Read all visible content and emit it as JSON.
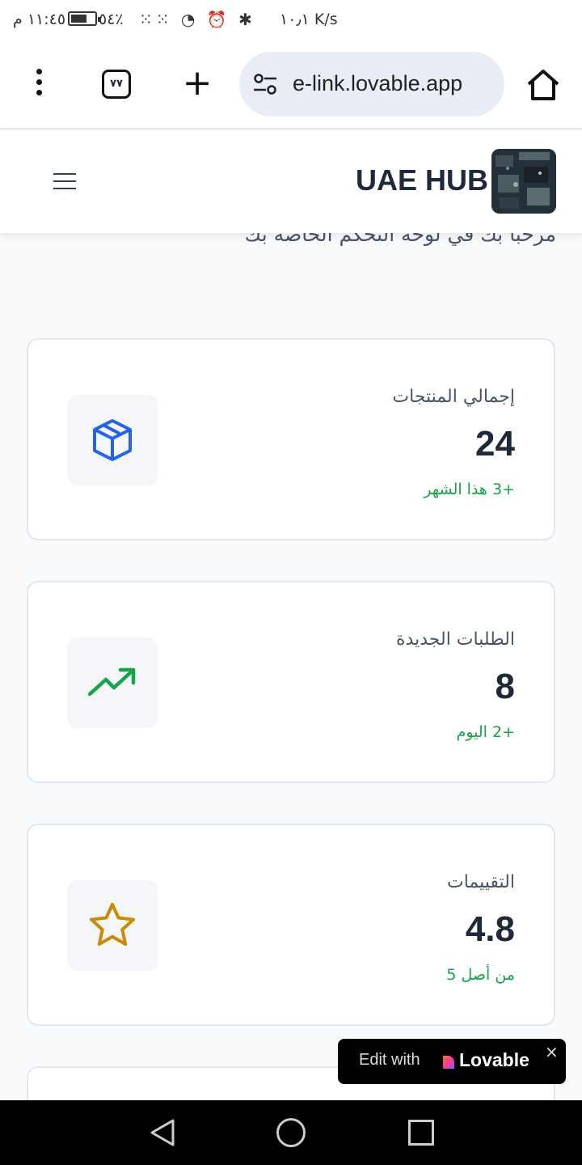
{
  "status_bar": {
    "time": "١١:٤٥ م",
    "battery": "٥٤٪",
    "indicators": "⁙⁙ ◔ ⏰ ✱",
    "net_speed": "١٠٫١ K/s"
  },
  "browser": {
    "tab_count": "٧٧",
    "url": "e-link.lovable.app",
    "icons": [
      "more-vert-icon",
      "tabs-icon",
      "plus-icon",
      "tune-icon",
      "home-icon"
    ]
  },
  "app": {
    "brand": "UAE HUB",
    "welcome": "مرحبا بك في لوحة التحكم الخاصة بك"
  },
  "stats": [
    {
      "label": "إجمالي المنتجات",
      "value": "24",
      "sub": "+3 هذا الشهر",
      "icon": "package-icon",
      "icon_color": "#2563eb"
    },
    {
      "label": "الطلبات الجديدة",
      "value": "8",
      "sub": "+2 اليوم",
      "icon": "trending-up-icon",
      "icon_color": "#16a34a"
    },
    {
      "label": "التقييمات",
      "value": "4.8",
      "sub": "من أصل 5",
      "icon": "star-icon",
      "icon_color": "#ca8a04"
    }
  ],
  "lovable_badge": {
    "edit_text": "Edit with",
    "name": "Lovable",
    "close": "×"
  },
  "colors": {
    "accent_green": "#16a34a",
    "page_bg": "#f8fafc",
    "text_dark": "#1e293b"
  }
}
